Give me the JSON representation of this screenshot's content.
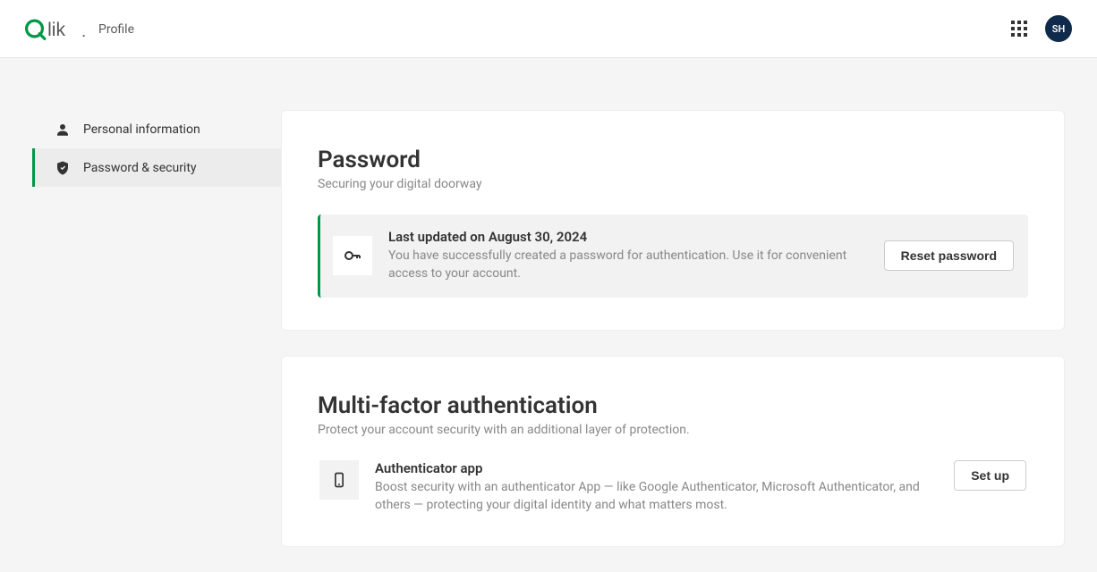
{
  "header": {
    "page_label": "Profile",
    "avatar_initials": "SH"
  },
  "sidebar": {
    "items": [
      {
        "label": "Personal information",
        "active": false
      },
      {
        "label": "Password & security",
        "active": true
      }
    ]
  },
  "password_card": {
    "title": "Password",
    "subtitle": "Securing your digital doorway",
    "status_title": "Last updated on August 30, 2024",
    "status_desc": "You have successfully created a password for authentication. Use it for convenient access to your account.",
    "button_label": "Reset password"
  },
  "mfa_card": {
    "title": "Multi-factor authentication",
    "subtitle": "Protect your account security with an additional layer of protection.",
    "item_title": "Authenticator app",
    "item_desc": "Boost security with an authenticator App — like Google Authenticator, Microsoft Authenticator, and others — protecting your digital identity and what matters most.",
    "button_label": "Set up"
  }
}
